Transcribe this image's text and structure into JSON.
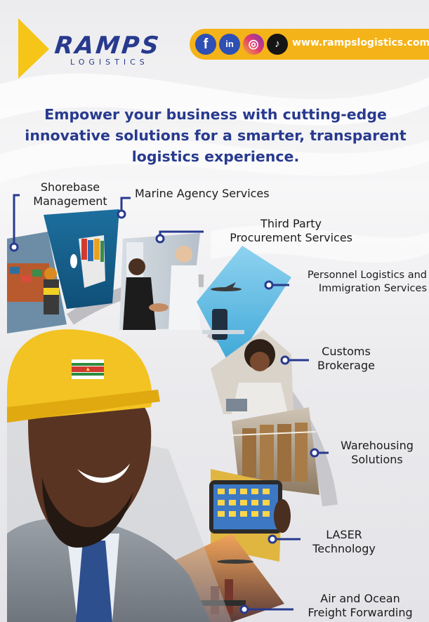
{
  "brand": {
    "name": "RAMPS",
    "sub": "LOGISTICS",
    "primary_color": "#283a8e",
    "accent_color": "#f4b318"
  },
  "social": {
    "icons": [
      "facebook-icon",
      "linkedin-icon",
      "instagram-icon",
      "tiktok-icon"
    ],
    "glyphs": {
      "facebook": "f",
      "linkedin": "in",
      "instagram": "◎",
      "tiktok": "♪"
    },
    "website": "www.rampslogistics.com"
  },
  "headline": {
    "line1": "Empower your business with cutting-edge",
    "line2": "innovative solutions for a smarter, transparent",
    "line3": "logistics experience."
  },
  "services": [
    {
      "line1": "Shorebase",
      "line2": "Management"
    },
    {
      "line1": "Marine Agency Services",
      "line2": ""
    },
    {
      "line1": "Third Party",
      "line2": "Procurement Services"
    },
    {
      "line1": "Personnel Logistics and",
      "line2": "Immigration Services"
    },
    {
      "line1": "Customs",
      "line2": "Brokerage"
    },
    {
      "line1": "Warehousing",
      "line2": "Solutions"
    },
    {
      "line1": "LASER",
      "line2": "Technology"
    },
    {
      "line1": "Air and Ocean",
      "line2": "Freight Forwarding"
    }
  ]
}
